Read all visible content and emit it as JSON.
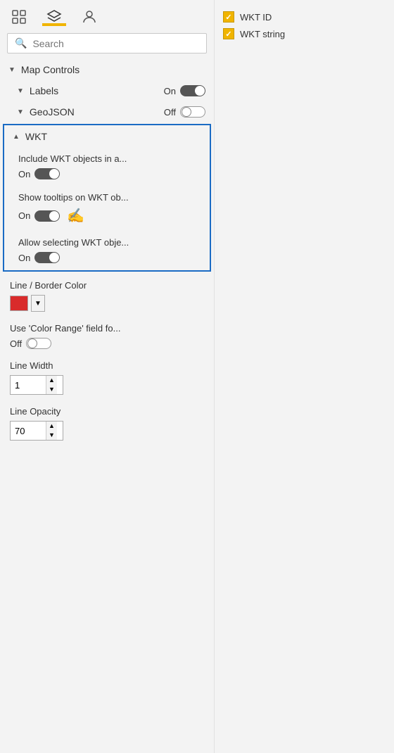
{
  "top_icons": [
    {
      "id": "grid-icon",
      "label": "grid",
      "active": false
    },
    {
      "id": "layers-icon",
      "label": "layers",
      "active": true
    },
    {
      "id": "person-icon",
      "label": "person",
      "active": false
    }
  ],
  "search": {
    "placeholder": "Search",
    "value": ""
  },
  "map_controls": {
    "label": "Map Controls",
    "collapsed": false
  },
  "labels_section": {
    "label": "Labels",
    "toggle_state": "On",
    "toggle_on": true
  },
  "geojson_section": {
    "label": "GeoJSON",
    "toggle_state": "Off",
    "toggle_on": false
  },
  "wkt_section": {
    "label": "WKT",
    "expanded": true,
    "settings": [
      {
        "id": "include-wkt",
        "label": "Include WKT objects in a...",
        "toggle_state": "On",
        "toggle_on": true
      },
      {
        "id": "show-tooltips",
        "label": "Show tooltips on WKT ob...",
        "toggle_state": "On",
        "toggle_on": true,
        "has_cursor": true
      },
      {
        "id": "allow-selecting",
        "label": "Allow selecting WKT obje...",
        "toggle_state": "On",
        "toggle_on": true
      }
    ]
  },
  "line_border_color": {
    "label": "Line / Border Color",
    "color": "#d92b2b"
  },
  "color_range": {
    "label": "Use 'Color Range' field fo...",
    "toggle_state": "Off",
    "toggle_on": false
  },
  "line_width": {
    "label": "Line Width",
    "value": "1"
  },
  "line_opacity": {
    "label": "Line Opacity",
    "value": "70"
  },
  "right_panel": {
    "checkboxes": [
      {
        "id": "wkt-id",
        "label": "WKT ID",
        "checked": true
      },
      {
        "id": "wkt-string",
        "label": "WKT string",
        "checked": true
      }
    ]
  }
}
